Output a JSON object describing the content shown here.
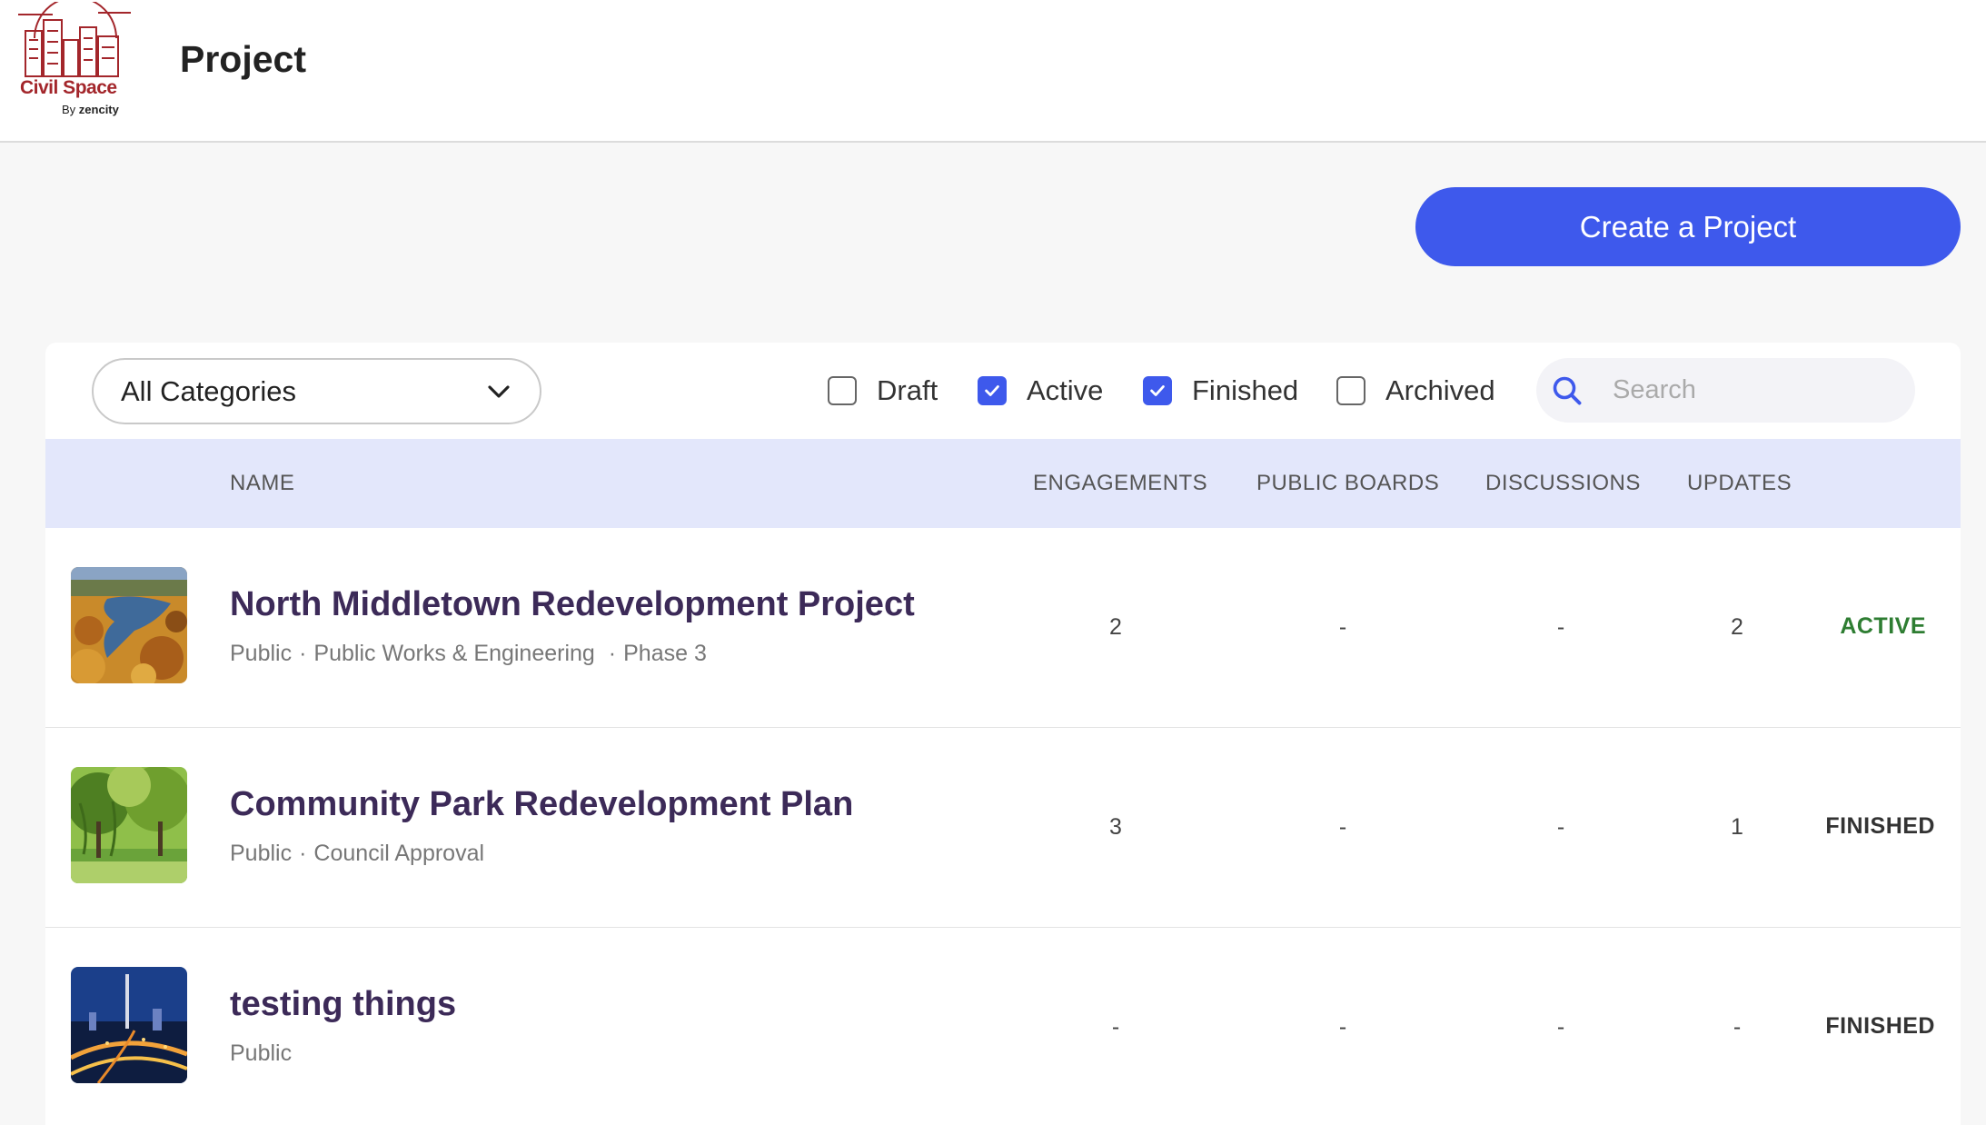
{
  "header": {
    "logo_brand": "Civil Space",
    "logo_by": "By",
    "logo_company": "zencity",
    "title": "Project"
  },
  "actions": {
    "create_label": "Create a Project"
  },
  "filters": {
    "category": "All Categories",
    "statuses": [
      {
        "label": "Draft",
        "checked": false
      },
      {
        "label": "Active",
        "checked": true
      },
      {
        "label": "Finished",
        "checked": true
      },
      {
        "label": "Archived",
        "checked": false
      }
    ],
    "search_placeholder": "Search"
  },
  "table": {
    "columns": {
      "name": "NAME",
      "engagements": "ENGAGEMENTS",
      "public_boards": "PUBLIC BOARDS",
      "discussions": "DISCUSSIONS",
      "updates": "UPDATES"
    },
    "rows": [
      {
        "title": "North Middletown Redevelopment Project",
        "meta": [
          "Public",
          "Public Works & Engineering",
          "Phase 3"
        ],
        "engagements": "2",
        "public_boards": "-",
        "discussions": "-",
        "updates": "2",
        "status": "ACTIVE",
        "status_color": "#2e7d32",
        "image": "lake-aerial-image"
      },
      {
        "title": "Community Park Redevelopment Plan",
        "meta": [
          "Public",
          "Council Approval"
        ],
        "engagements": "3",
        "public_boards": "-",
        "discussions": "-",
        "updates": "1",
        "status": "FINISHED",
        "status_color": "#333333",
        "image": "park-image"
      },
      {
        "title": "testing things",
        "meta": [
          "Public"
        ],
        "engagements": "-",
        "public_boards": "-",
        "discussions": "-",
        "updates": "-",
        "status": "FINISHED",
        "status_color": "#333333",
        "image": "city-night-image"
      }
    ]
  },
  "colors": {
    "accent": "#3e59ec",
    "header_row": "#e3e7fb",
    "title_text": "#3c2a58"
  }
}
